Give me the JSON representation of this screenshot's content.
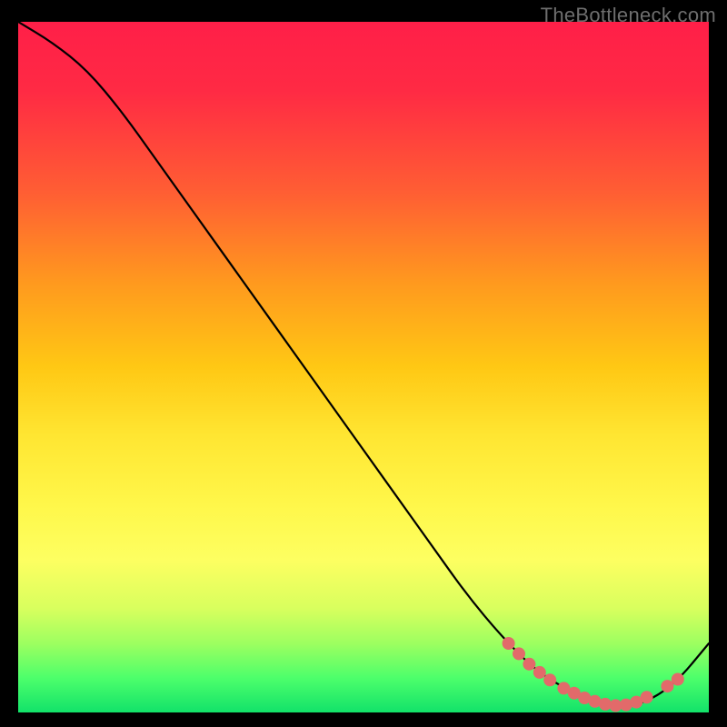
{
  "watermark": "TheBottleneck.com",
  "colors": {
    "background": "#000000",
    "curve": "#000000",
    "dots": "#e26a6a",
    "gradient_top": "#ff1f48",
    "gradient_bottom": "#12e26a"
  },
  "chart_data": {
    "type": "line",
    "title": "",
    "xlabel": "",
    "ylabel": "",
    "xlim": [
      0,
      100
    ],
    "ylim": [
      0,
      100
    ],
    "x": [
      0,
      5,
      10,
      15,
      20,
      25,
      30,
      35,
      40,
      45,
      50,
      55,
      60,
      65,
      70,
      75,
      80,
      85,
      90,
      95,
      100
    ],
    "values": [
      100,
      97,
      93,
      87,
      80,
      73,
      66,
      59,
      52,
      45,
      38,
      31,
      24,
      17,
      11,
      6,
      3,
      1,
      1,
      4,
      10
    ],
    "highlight_points": [
      {
        "x": 71,
        "y": 10.0
      },
      {
        "x": 72.5,
        "y": 8.5
      },
      {
        "x": 74,
        "y": 7.0
      },
      {
        "x": 75.5,
        "y": 5.8
      },
      {
        "x": 77,
        "y": 4.7
      },
      {
        "x": 79,
        "y": 3.5
      },
      {
        "x": 80.5,
        "y": 2.8
      },
      {
        "x": 82,
        "y": 2.1
      },
      {
        "x": 83.5,
        "y": 1.6
      },
      {
        "x": 85,
        "y": 1.2
      },
      {
        "x": 86.5,
        "y": 1.0
      },
      {
        "x": 88,
        "y": 1.1
      },
      {
        "x": 89.5,
        "y": 1.5
      },
      {
        "x": 91,
        "y": 2.2
      },
      {
        "x": 94,
        "y": 3.8
      },
      {
        "x": 95.5,
        "y": 4.8
      }
    ]
  }
}
